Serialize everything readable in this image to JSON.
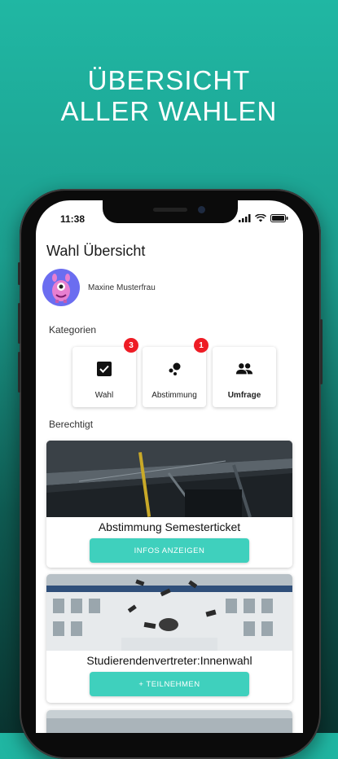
{
  "headline": {
    "line1": "ÜBERSICHT",
    "line2": "ALLER WAHLEN"
  },
  "status": {
    "time": "11:38"
  },
  "app": {
    "title": "Wahl Übersicht",
    "user_name": "Maxine Musterfrau"
  },
  "sections": {
    "categories_label": "Kategorien",
    "eligible_label": "Berechtigt"
  },
  "categories": [
    {
      "label": "Wahl",
      "icon": "checkbox-icon",
      "badge": "3"
    },
    {
      "label": "Abstimmung",
      "icon": "bubble-chart-icon",
      "badge": "1"
    },
    {
      "label": "Umfrage",
      "icon": "people-icon",
      "badge": ""
    }
  ],
  "cards": [
    {
      "title": "Abstimmung Semesterticket",
      "button": "INFOS ANZEIGEN"
    },
    {
      "title": "Studierendenvertreter:Innenwahl",
      "button": "+ TEILNEHMEN"
    }
  ],
  "colors": {
    "accent": "#3fd0bd",
    "badge": "#ee1c25",
    "bg_top": "#20b7a3",
    "bg_bottom": "#0a3531"
  }
}
